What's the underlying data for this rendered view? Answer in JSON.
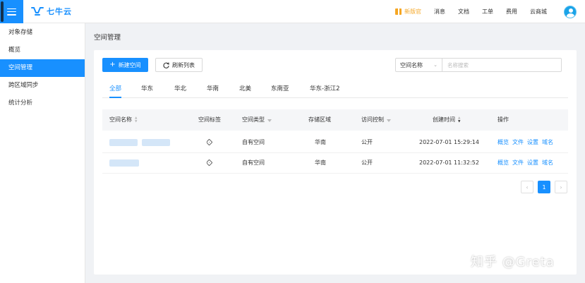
{
  "header": {
    "logo_text": "七牛云",
    "nav": [
      "新版官",
      "消息",
      "文档",
      "工单",
      "费用",
      "云商城"
    ]
  },
  "sidebar": {
    "items": [
      "对象存储",
      "概览",
      "空间管理",
      "跨区域同步",
      "统计分析"
    ],
    "active_index": 2
  },
  "page": {
    "title": "空间管理"
  },
  "toolbar": {
    "new_label": "新建空间",
    "refresh_label": "刷新列表",
    "search_field": "空间名称",
    "search_placeholder": "名称搜索"
  },
  "tabs": [
    "全部",
    "华东",
    "华北",
    "华南",
    "北美",
    "东南亚",
    "华东-浙江2"
  ],
  "table": {
    "columns": [
      "空间名称",
      "空间标签",
      "空间类型",
      "存储区域",
      "访问控制",
      "创建时间",
      "操作"
    ],
    "rows": [
      {
        "type": "自有空间",
        "region": "华南",
        "access": "公开",
        "created": "2022-07-01 15:29:14"
      },
      {
        "type": "自有空间",
        "region": "华南",
        "access": "公开",
        "created": "2022-07-01 11:32:52"
      }
    ],
    "actions": [
      "概览",
      "文件",
      "设置",
      "域名"
    ]
  },
  "pagination": {
    "prev": "‹",
    "current": "1",
    "next": "›"
  },
  "watermark": "知乎 @Greta",
  "colors": {
    "accent": "#1890ff",
    "promo": "#f5a623"
  }
}
